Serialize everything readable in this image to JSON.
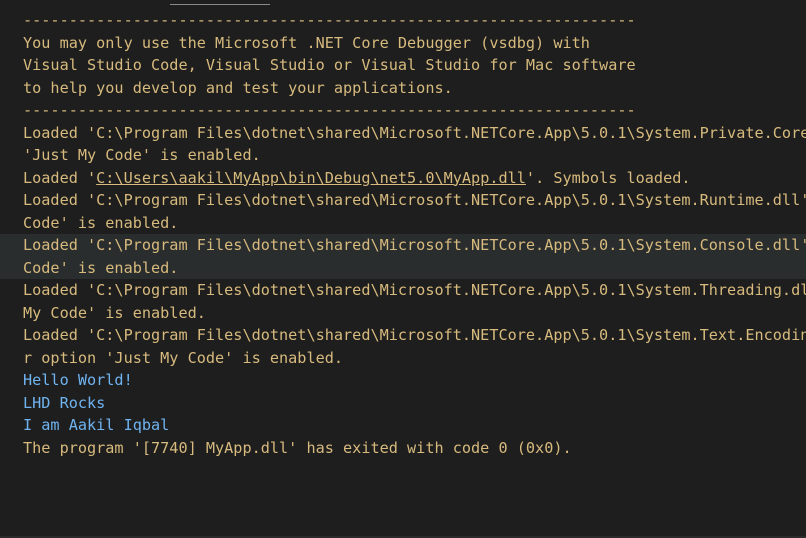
{
  "console": {
    "lines": [
      {
        "text": "-------------------------------------------------------------------",
        "kind": "program"
      },
      {
        "text": "You may only use the Microsoft .NET Core Debugger (vsdbg) with",
        "kind": "program"
      },
      {
        "text": "Visual Studio Code, Visual Studio or Visual Studio for Mac software",
        "kind": "program"
      },
      {
        "text": "to help you develop and test your applications.",
        "kind": "program"
      },
      {
        "text": "-------------------------------------------------------------------",
        "kind": "program"
      },
      {
        "text": "Loaded 'C:\\Program Files\\dotnet\\shared\\Microsoft.NETCore.App\\5.0.1\\System.Private.CoreLib.dll'. Skipped loading symbols. Module is optimized and the debugger option",
        "kind": "program"
      },
      {
        "text": "'Just My Code' is enabled.",
        "kind": "program"
      },
      {
        "prefix": "Loaded '",
        "link": "C:\\Users\\aakil\\MyApp\\bin\\Debug\\net5.0\\MyApp.dll",
        "suffix": "'. Symbols loaded.",
        "kind": "program"
      },
      {
        "text": "Loaded 'C:\\Program Files\\dotnet\\shared\\Microsoft.NETCore.App\\5.0.1\\System.Runtime.dll'. Skipped loading symbols. Module is optimized and the debugger option 'Just My",
        "kind": "program"
      },
      {
        "text": "Code' is enabled.",
        "kind": "program"
      },
      {
        "text": "Loaded 'C:\\Program Files\\dotnet\\shared\\Microsoft.NETCore.App\\5.0.1\\System.Console.dll'. Skipped loading symbols. Module is optimized and the debugger option 'Just My",
        "kind": "program"
      },
      {
        "text": "Code' is enabled.",
        "kind": "program"
      },
      {
        "text": "Loaded 'C:\\Program Files\\dotnet\\shared\\Microsoft.NETCore.App\\5.0.1\\System.Threading.dll'. Skipped loading symbols. Module is optimized and the debugger option 'Just",
        "kind": "program"
      },
      {
        "text": "My Code' is enabled.",
        "kind": "program"
      },
      {
        "text": "Loaded 'C:\\Program Files\\dotnet\\shared\\Microsoft.NETCore.App\\5.0.1\\System.Text.Encoding.Extensions.dll'. Skipped loading symbols. Module is optimized and the debugge",
        "kind": "program"
      },
      {
        "text": "r option 'Just My Code' is enabled.",
        "kind": "program"
      },
      {
        "text": "Hello World!",
        "kind": "output"
      },
      {
        "text": "LHD Rocks",
        "kind": "output"
      },
      {
        "text": "I am Aakil Iqbal",
        "kind": "output"
      },
      {
        "text": "The program '[7740] MyApp.dll' has exited with code 0 (0x0).",
        "kind": "program"
      }
    ]
  },
  "colors": {
    "background": "#1e1e1e",
    "program_text": "#d7ba7d",
    "output_text": "#6fb3f0",
    "hover_row": "#2a2d2e"
  }
}
